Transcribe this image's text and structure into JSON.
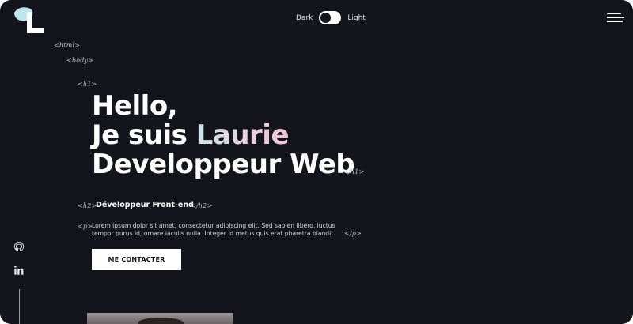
{
  "theme_toggle": {
    "dark_label": "Dark",
    "light_label": "Light",
    "state": "dark"
  },
  "tags": {
    "html_open": "<html>",
    "body_open": "<body>",
    "h1_open": "<h1>",
    "h1_close": "</h1>",
    "h2_open": "<h2>",
    "h2_close": "</h2>",
    "p_open": "<p>",
    "p_close": "</p>"
  },
  "hero": {
    "line1": "Hello,",
    "line2_prefix": "Je suis ",
    "line2_name": "Laurie",
    "line3": "Developpeur Web"
  },
  "subtitle": "Développeur Front-end",
  "paragraph": "Lorem ipsum dolor sit amet, consectetur adipiscing elit. Sed sapien libero, luctus tempor purus id, ornare iaculis nulla. Integer id metus quis erat pharetra blandit.",
  "cta_label": "ME CONTACTER",
  "social": [
    {
      "icon": "github-icon"
    },
    {
      "icon": "linkedin-icon"
    }
  ],
  "colors": {
    "background": "#13141c",
    "text": "#ffffff",
    "name_gradient_start": "#cfe6ef",
    "name_gradient_end": "#f3c7d6",
    "logo_accent": "#bde6ee"
  }
}
